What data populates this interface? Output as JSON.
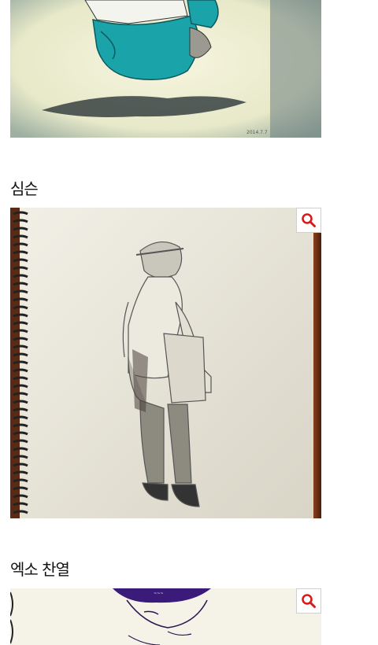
{
  "posts": [
    {
      "title": "",
      "image_alt": "teal watercolor drawing of a figure's legs with shadow",
      "zoom_icon": "search-icon"
    },
    {
      "title": "심슨",
      "image_alt": "pencil sketch of a person in a cap holding a tote bag on spiral sketchbook",
      "zoom_icon": "search-icon"
    },
    {
      "title": "엑소 찬열",
      "image_alt": "purple ink drawing of a face",
      "zoom_icon": "search-icon"
    }
  ],
  "colors": {
    "zoom_glass": "#d71a1a",
    "teal": "#1aa3a8",
    "paper": "#f3f0d8",
    "purple": "#3b1b7a"
  }
}
